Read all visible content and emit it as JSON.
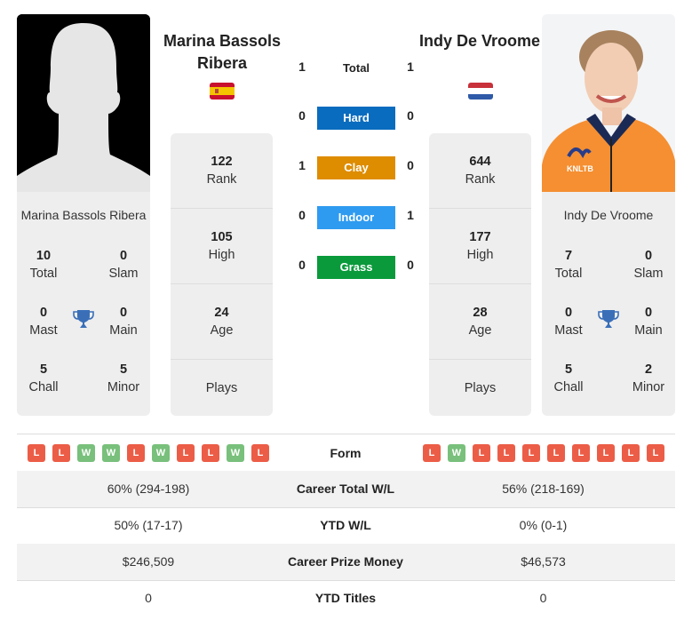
{
  "player1": {
    "name": "Marina Bassols Ribera",
    "country_flag": "spain-flag",
    "photo": "silhouette-placeholder",
    "titles": {
      "total": {
        "value": "10",
        "label": "Total"
      },
      "slam": {
        "value": "0",
        "label": "Slam"
      },
      "mast": {
        "value": "0",
        "label": "Mast"
      },
      "main": {
        "value": "0",
        "label": "Main"
      },
      "chall": {
        "value": "5",
        "label": "Chall"
      },
      "minor": {
        "value": "5",
        "label": "Minor"
      }
    },
    "stats": {
      "rank": {
        "value": "122",
        "label": "Rank"
      },
      "high": {
        "value": "105",
        "label": "High"
      },
      "age": {
        "value": "24",
        "label": "Age"
      },
      "plays": {
        "value": "",
        "label": "Plays"
      }
    },
    "form": [
      "L",
      "L",
      "W",
      "W",
      "L",
      "W",
      "L",
      "L",
      "W",
      "L"
    ]
  },
  "player2": {
    "name": "Indy De Vroome",
    "country_flag": "netherlands-flag",
    "photo": "player-photo",
    "titles": {
      "total": {
        "value": "7",
        "label": "Total"
      },
      "slam": {
        "value": "0",
        "label": "Slam"
      },
      "mast": {
        "value": "0",
        "label": "Mast"
      },
      "main": {
        "value": "0",
        "label": "Main"
      },
      "chall": {
        "value": "5",
        "label": "Chall"
      },
      "minor": {
        "value": "2",
        "label": "Minor"
      }
    },
    "stats": {
      "rank": {
        "value": "644",
        "label": "Rank"
      },
      "high": {
        "value": "177",
        "label": "High"
      },
      "age": {
        "value": "28",
        "label": "Age"
      },
      "plays": {
        "value": "",
        "label": "Plays"
      }
    },
    "form": [
      "L",
      "W",
      "L",
      "L",
      "L",
      "L",
      "L",
      "L",
      "L",
      "L"
    ]
  },
  "h2h": {
    "total": {
      "label": "Total",
      "p1": "1",
      "p2": "1"
    },
    "surfaces": [
      {
        "label": "Hard",
        "p1": "0",
        "p2": "0",
        "color": "#0a6cbe"
      },
      {
        "label": "Clay",
        "p1": "1",
        "p2": "0",
        "color": "#de8c00"
      },
      {
        "label": "Indoor",
        "p1": "0",
        "p2": "1",
        "color": "#2e9bf0"
      },
      {
        "label": "Grass",
        "p1": "0",
        "p2": "0",
        "color": "#0a9a3b"
      }
    ]
  },
  "comparison": {
    "form_label": "Form",
    "rows": [
      {
        "label": "Career Total W/L",
        "p1": "60% (294-198)",
        "p2": "56% (218-169)"
      },
      {
        "label": "YTD W/L",
        "p1": "50% (17-17)",
        "p2": "0% (0-1)"
      },
      {
        "label": "Career Prize Money",
        "p1": "$246,509",
        "p2": "$46,573"
      },
      {
        "label": "YTD Titles",
        "p1": "0",
        "p2": "0"
      }
    ]
  },
  "colors": {
    "win": "#78c07b",
    "loss": "#ec5d47",
    "trophy": "#3a6fb8"
  }
}
